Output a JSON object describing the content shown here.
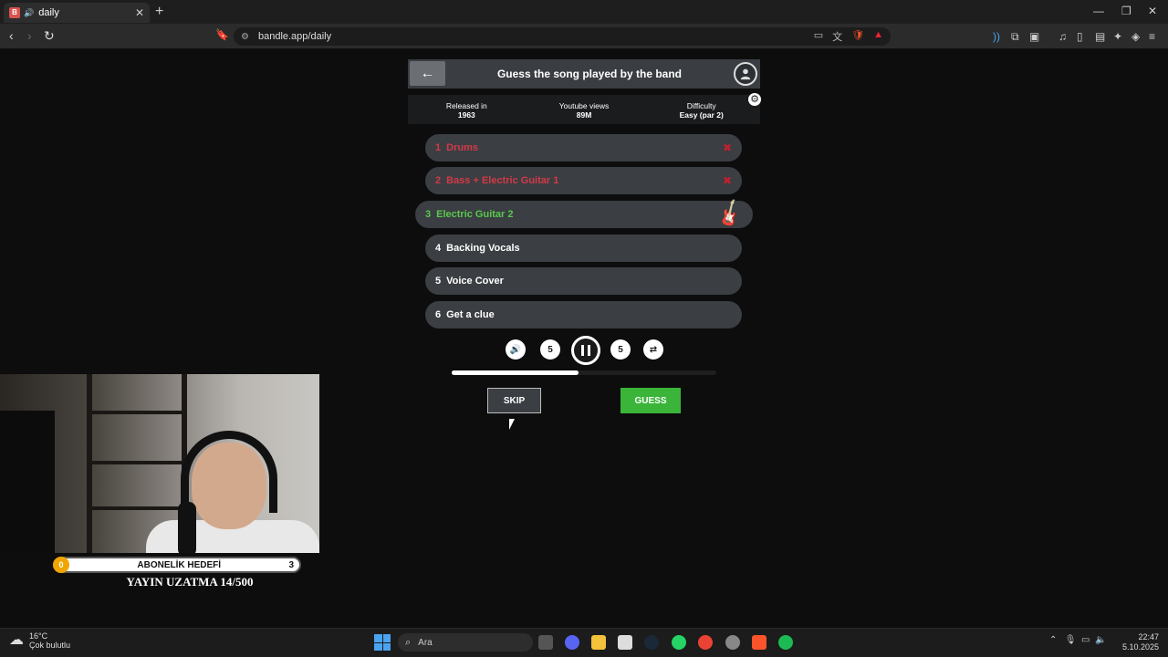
{
  "browser": {
    "tab_title": "daily",
    "url": "bandle.app/daily"
  },
  "game": {
    "title": "Guess the song played by the band",
    "info": [
      {
        "label": "Released in",
        "value": "1963"
      },
      {
        "label": "Youtube views",
        "value": "89M"
      },
      {
        "label": "Difficulty",
        "value": "Easy (par 2)"
      }
    ],
    "tracks": [
      {
        "num": "1",
        "label": "Drums",
        "state": "wrong"
      },
      {
        "num": "2",
        "label": "Bass + Electric Guitar 1",
        "state": "wrong"
      },
      {
        "num": "3",
        "label": "Electric Guitar 2",
        "state": "current"
      },
      {
        "num": "4",
        "label": "Backing Vocals",
        "state": "locked"
      },
      {
        "num": "5",
        "label": "Voice Cover",
        "state": "locked"
      },
      {
        "num": "6",
        "label": "Get a clue",
        "state": "locked"
      }
    ],
    "progress": 0.48,
    "skip_label": "SKIP",
    "guess_label": "GUESS",
    "rewind_seconds": "5",
    "forward_seconds": "5"
  },
  "stream": {
    "sub_goal_label": "ABONELİK HEDEFİ",
    "sub_goal_current": "0",
    "sub_goal_target": "3",
    "extension_text": "YAYIN UZATMA 14/500"
  },
  "taskbar": {
    "weather_temp": "16°C",
    "weather_desc": "Çok bulutlu",
    "search_placeholder": "Ara",
    "time": "22:47",
    "date": "5.10.2025"
  },
  "colors": {
    "wrong": "#d23a48",
    "current": "#59c94e",
    "guess": "#3ab53a"
  }
}
